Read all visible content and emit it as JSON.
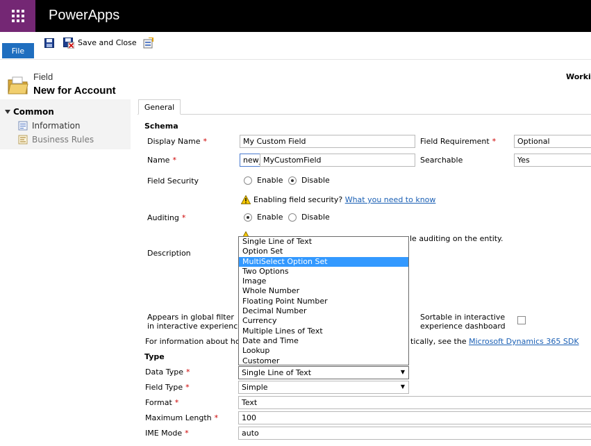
{
  "app": {
    "title": "PowerApps"
  },
  "ribbon": {
    "file": "File",
    "save_close": "Save and Close"
  },
  "header": {
    "entity_type": "Field",
    "title": "New for Account",
    "working": "Workin"
  },
  "nav": {
    "group": "Common",
    "items": [
      {
        "label": "Information"
      },
      {
        "label": "Business Rules"
      }
    ]
  },
  "tab": {
    "label": "General"
  },
  "schema": {
    "heading": "Schema",
    "display_name_label": "Display Name",
    "display_name_value": "My Custom Field",
    "field_requirement_label": "Field Requirement",
    "field_requirement_value": "Optional",
    "name_label": "Name",
    "name_prefix": "new_",
    "name_value": "MyCustomField",
    "searchable_label": "Searchable",
    "searchable_value": "Yes",
    "field_security_label": "Field Security",
    "enable": "Enable",
    "disable": "Disable",
    "security_warning": "Enabling field security?",
    "security_link": "What you need to know",
    "auditing_label": "Auditing",
    "audit_warning_tail": "le auditing on the entity.",
    "description_label": "Description",
    "global_filter_line1": "Appears in global filter",
    "global_filter_line2": "in interactive experience",
    "sortable_line1": "Sortable in interactive",
    "sortable_line2": "experience dashboard",
    "info_prefix": "For information about hov",
    "info_suffix": "tically, see the",
    "sdk_link": "Microsoft Dynamics 365 SDK"
  },
  "type_section": {
    "heading": "Type",
    "data_type_label": "Data Type",
    "data_type_value": "Single Line of Text",
    "field_type_label": "Field Type",
    "field_type_value": "Simple",
    "format_label": "Format",
    "format_value": "Text",
    "max_length_label": "Maximum Length",
    "max_length_value": "100",
    "ime_mode_label": "IME Mode",
    "ime_mode_value": "auto"
  },
  "data_type_options": [
    "Single Line of Text",
    "Option Set",
    "MultiSelect Option Set",
    "Two Options",
    "Image",
    "Whole Number",
    "Floating Point Number",
    "Decimal Number",
    "Currency",
    "Multiple Lines of Text",
    "Date and Time",
    "Lookup",
    "Customer"
  ],
  "highlighted_option": "MultiSelect Option Set",
  "colors": {
    "brand": "#742774",
    "topbar": "#000000",
    "file": "#1f6ebf",
    "highlight": "#3399ff"
  }
}
